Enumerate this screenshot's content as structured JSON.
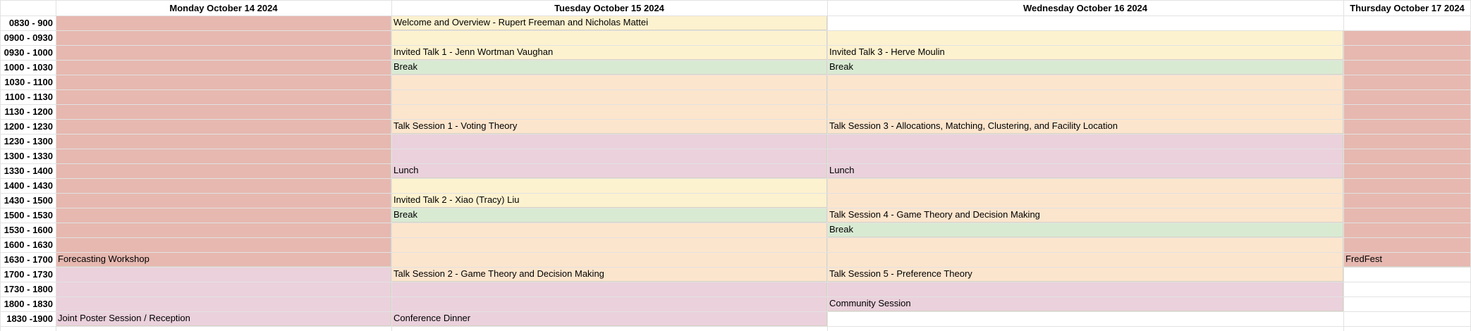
{
  "days": [
    {
      "key": "mon",
      "label": "Monday October 14 2024"
    },
    {
      "key": "tue",
      "label": "Tuesday October 15 2024"
    },
    {
      "key": "wed",
      "label": "Wednesday October 16 2024"
    },
    {
      "key": "thu",
      "label": "Thursday October 17 2024"
    }
  ],
  "time_slots": [
    "0830 - 900",
    "0900 - 0930",
    "0930 - 1000",
    "1000 - 1030",
    "1030 - 1100",
    "1100 - 1130",
    "1130 - 1200",
    "1200 - 1230",
    "1230 - 1300",
    "1300 - 1330",
    "1330 - 1400",
    "1400 - 1430",
    "1430 - 1500",
    "1500 - 1530",
    "1530 - 1600",
    "1600 - 1630",
    "1630 - 1700",
    "1700 - 1730",
    "1730 - 1800",
    "1800 - 1830",
    "1830 -1900"
  ],
  "colors": {
    "workshop": "#e6b8b0",
    "invited": "#fdf2cf",
    "break": "#d9ead3",
    "talk": "#fce5cd",
    "social": "#ead1dc"
  },
  "events": [
    {
      "day": 0,
      "start": 0,
      "end": 16,
      "title": "Forecasting Workshop",
      "kind": "workshop"
    },
    {
      "day": 0,
      "start": 17,
      "end": 20,
      "title": "Joint Poster Session / Reception",
      "kind": "social"
    },
    {
      "day": 1,
      "start": 0,
      "end": 0,
      "title": "Welcome and Overview - Rupert Freeman and Nicholas Mattei",
      "kind": "invited"
    },
    {
      "day": 1,
      "start": 1,
      "end": 2,
      "title": "Invited Talk 1 - Jenn Wortman Vaughan",
      "kind": "invited"
    },
    {
      "day": 1,
      "start": 3,
      "end": 3,
      "title": "Break",
      "kind": "break"
    },
    {
      "day": 1,
      "start": 4,
      "end": 7,
      "title": "Talk Session 1 - Voting Theory",
      "kind": "talk"
    },
    {
      "day": 1,
      "start": 8,
      "end": 10,
      "title": "Lunch",
      "kind": "social"
    },
    {
      "day": 1,
      "start": 11,
      "end": 12,
      "title": "Invited Talk 2 - Xiao (Tracy) Liu",
      "kind": "invited"
    },
    {
      "day": 1,
      "start": 13,
      "end": 13,
      "title": "Break",
      "kind": "break"
    },
    {
      "day": 1,
      "start": 14,
      "end": 17,
      "title": "Talk Session 2 - Game Theory and Decision Making",
      "kind": "talk"
    },
    {
      "day": 1,
      "start": 18,
      "end": 20,
      "title": "Conference Dinner",
      "kind": "social"
    },
    {
      "day": 2,
      "start": 1,
      "end": 2,
      "title": "Invited Talk 3 - Herve Moulin",
      "kind": "invited"
    },
    {
      "day": 2,
      "start": 3,
      "end": 3,
      "title": "Break",
      "kind": "break"
    },
    {
      "day": 2,
      "start": 4,
      "end": 7,
      "title": "Talk Session 3 - Allocations, Matching, Clustering, and Facility Location",
      "kind": "talk"
    },
    {
      "day": 2,
      "start": 8,
      "end": 10,
      "title": "Lunch",
      "kind": "social"
    },
    {
      "day": 2,
      "start": 11,
      "end": 13,
      "title": "Talk Session 4 - Game Theory and Decision Making",
      "kind": "talk"
    },
    {
      "day": 2,
      "start": 14,
      "end": 14,
      "title": "Break",
      "kind": "break"
    },
    {
      "day": 2,
      "start": 15,
      "end": 17,
      "title": "Talk Session 5 - Preference Theory",
      "kind": "talk"
    },
    {
      "day": 2,
      "start": 18,
      "end": 19,
      "title": "Community Session",
      "kind": "social"
    },
    {
      "day": 3,
      "start": 1,
      "end": 16,
      "title": "FredFest",
      "kind": "workshop"
    }
  ]
}
